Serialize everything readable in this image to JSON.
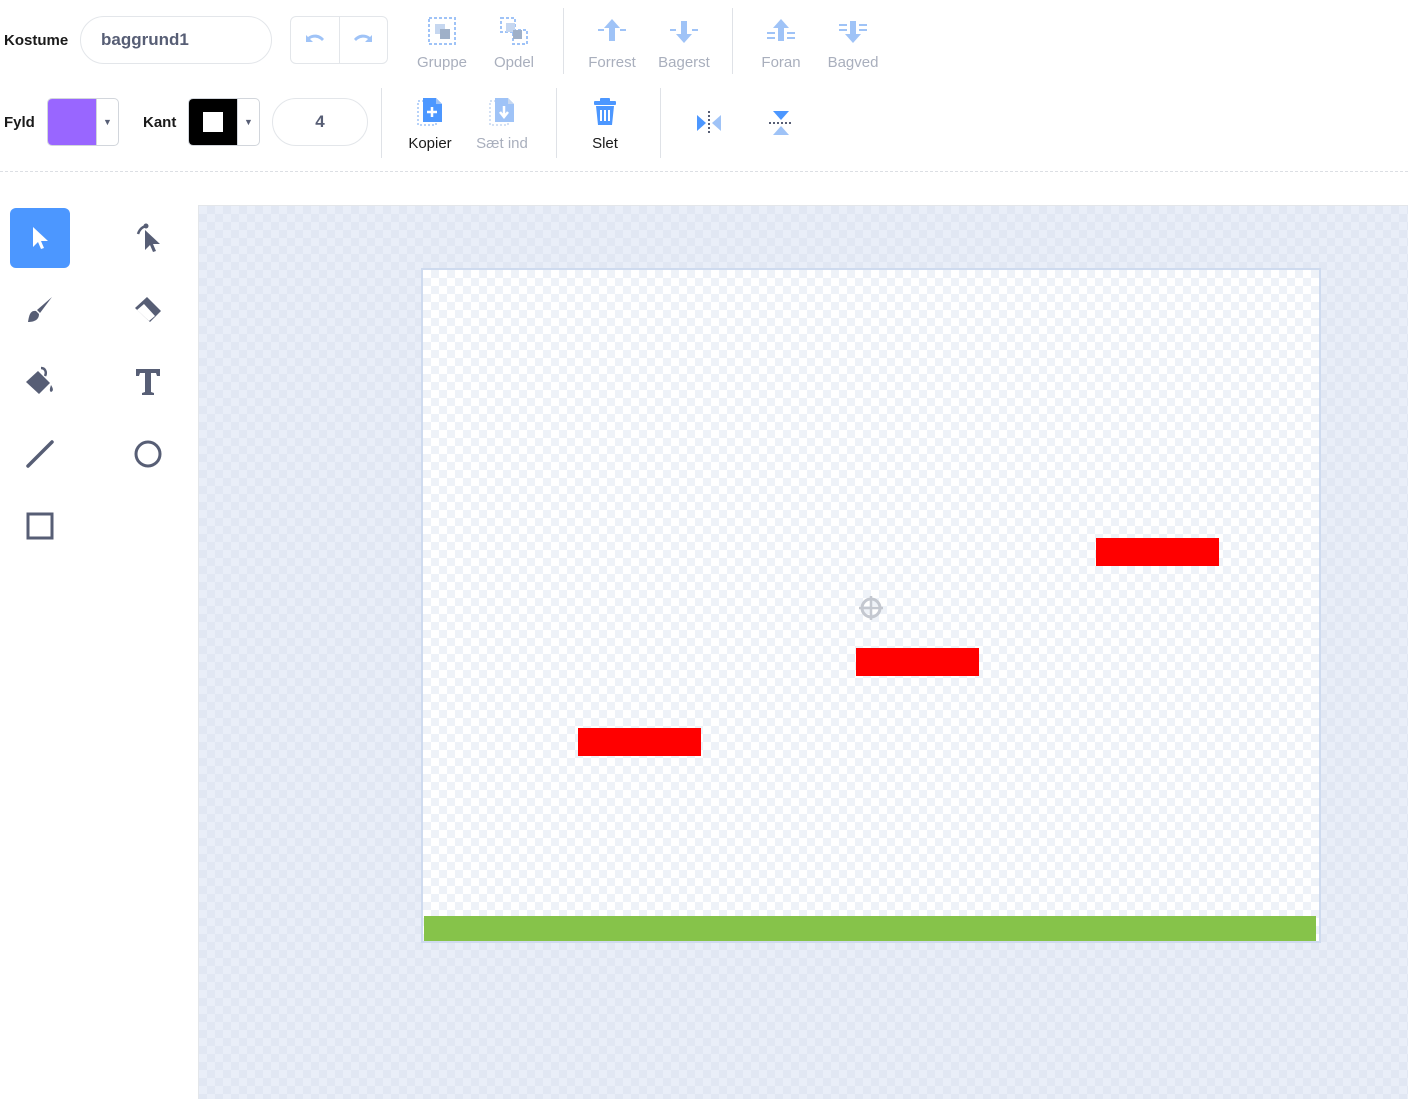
{
  "costume": {
    "label": "Kostume",
    "name_value": "baggrund1"
  },
  "toolbar": {
    "group_label": "Gruppe",
    "ungroup_label": "Opdel",
    "forward_most_label": "Forrest",
    "backward_most_label": "Bagerst",
    "forward_label": "Foran",
    "backward_label": "Bagved",
    "copy_label": "Kopier",
    "paste_label": "Sæt ind",
    "delete_label": "Slet"
  },
  "fill": {
    "label": "Fyld",
    "color": "#9966ff"
  },
  "outline": {
    "label": "Kant",
    "color": "#000000",
    "width_value": "4"
  },
  "tools": [
    {
      "name": "select-tool",
      "icon": "arrow-cursor-icon",
      "active": true
    },
    {
      "name": "reshape-tool",
      "icon": "reshape-cursor-icon",
      "active": false
    },
    {
      "name": "brush-tool",
      "icon": "brush-icon",
      "active": false
    },
    {
      "name": "eraser-tool",
      "icon": "eraser-icon",
      "active": false
    },
    {
      "name": "fill-tool",
      "icon": "paint-bucket-icon",
      "active": false
    },
    {
      "name": "text-tool",
      "icon": "text-icon",
      "active": false
    },
    {
      "name": "line-tool",
      "icon": "line-icon",
      "active": false
    },
    {
      "name": "circle-tool",
      "icon": "circle-icon",
      "active": false
    },
    {
      "name": "rectangle-tool",
      "icon": "rectangle-icon",
      "active": false
    }
  ],
  "colors": {
    "accent": "#4c97ff",
    "platform": "#ff0000",
    "ground": "#86c34a",
    "disabled_icon": "#9fc3f7"
  }
}
